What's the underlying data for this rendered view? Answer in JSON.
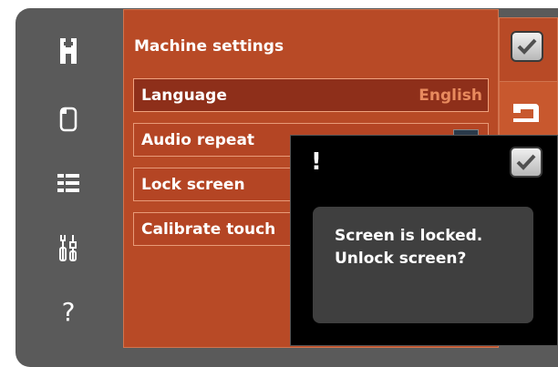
{
  "sidebar": {
    "items": [
      {
        "icon": "home-icon"
      },
      {
        "icon": "edit-icon"
      },
      {
        "icon": "menu-icon"
      },
      {
        "icon": "tools-icon"
      },
      {
        "icon": "help-icon",
        "glyph": "?"
      }
    ]
  },
  "panel": {
    "title": "Machine settings",
    "rows": [
      {
        "label": "Language",
        "value": "English"
      },
      {
        "label": "Audio repeat"
      },
      {
        "label": "Lock screen"
      },
      {
        "label": "Calibrate touch"
      }
    ]
  },
  "dialog": {
    "symbol": "!",
    "message_line1": "Screen is locked.",
    "message_line2": "Unlock screen?"
  },
  "colors": {
    "frame": "#5a5a5a",
    "panel": "#b84a26",
    "accent_value": "#e88a5e",
    "dialog_bg": "#000000",
    "message_bg": "#3f3f3f"
  }
}
